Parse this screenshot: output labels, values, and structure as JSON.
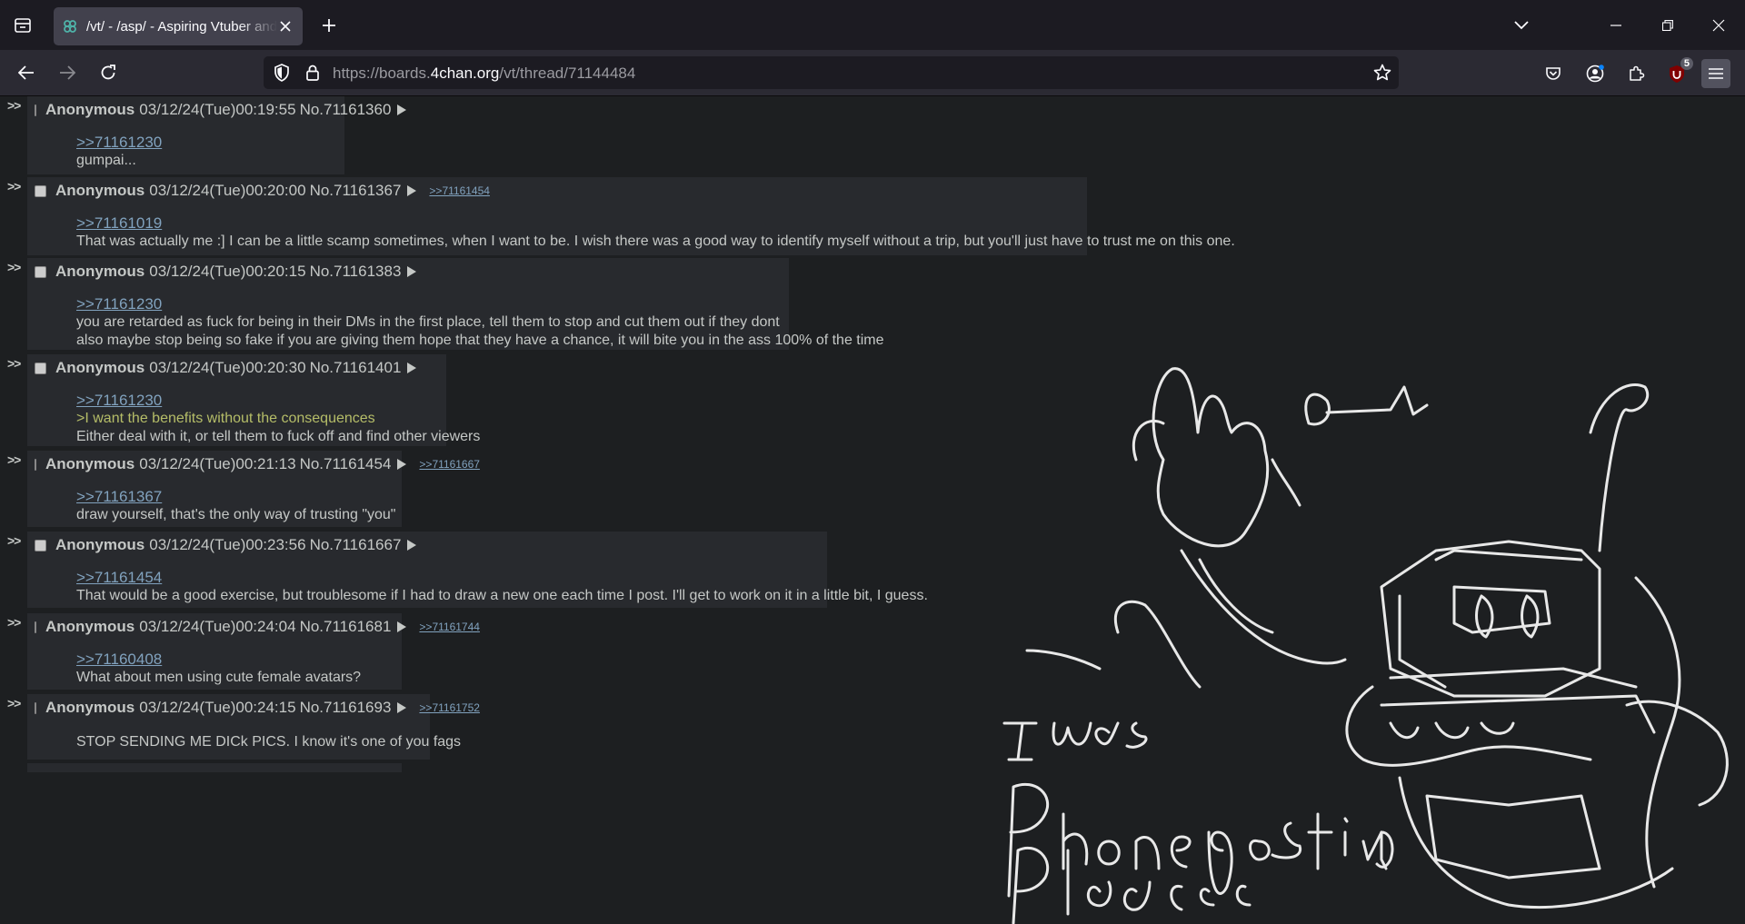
{
  "browser": {
    "tab_title": "/vt/ - /asp/ - Aspiring Vtuber and",
    "url_prefix": "https://boards.",
    "url_domain": "4chan.org",
    "url_path": "/vt/thread/71144484",
    "extension_badge": "5"
  },
  "posts": [
    {
      "arrows": ">>",
      "name": "Anonymous",
      "datetime": "03/12/24(Tue)00:19:55",
      "number": "No.71161360",
      "backlinks": [],
      "quote": ">>71161230",
      "greentext": "",
      "lines": [
        "gumpai..."
      ]
    },
    {
      "arrows": ">>",
      "name": "Anonymous",
      "datetime": "03/12/24(Tue)00:20:00",
      "number": "No.71161367",
      "backlinks": [
        ">>71161454"
      ],
      "quote": ">>71161019",
      "greentext": "",
      "lines": [
        "That was actually me :] I can be a little scamp sometimes, when I want to be. I wish there was a good way to identify myself without a trip, but you'll just have to trust me on this one."
      ]
    },
    {
      "arrows": ">>",
      "name": "Anonymous",
      "datetime": "03/12/24(Tue)00:20:15",
      "number": "No.71161383",
      "backlinks": [],
      "quote": ">>71161230",
      "greentext": "",
      "lines": [
        "you are retarded as fuck for being in their DMs in the first place, tell them to stop and cut them out if they dont",
        "also maybe stop being so fake if you are giving them hope that they have a chance, it will bite you in the ass 100% of the time"
      ]
    },
    {
      "arrows": ">>",
      "name": "Anonymous",
      "datetime": "03/12/24(Tue)00:20:30",
      "number": "No.71161401",
      "backlinks": [],
      "quote": ">>71161230",
      "greentext": ">I want the benefits without the consequences",
      "lines": [
        "Either deal with it, or tell them to fuck off and find other viewers"
      ]
    },
    {
      "arrows": ">>",
      "name": "Anonymous",
      "datetime": "03/12/24(Tue)00:21:13",
      "number": "No.71161454",
      "backlinks": [
        ">>71161667"
      ],
      "quote": ">>71161367",
      "greentext": "",
      "lines": [
        "draw yourself, that's the only way of trusting \"you\""
      ]
    },
    {
      "arrows": ">>",
      "name": "Anonymous",
      "datetime": "03/12/24(Tue)00:23:56",
      "number": "No.71161667",
      "backlinks": [],
      "quote": ">>71161454",
      "greentext": "",
      "lines": [
        "That would be a good exercise, but troublesome if I had to draw a new one each time I post. I'll get to work on it in a little bit, I guess."
      ]
    },
    {
      "arrows": ">>",
      "name": "Anonymous",
      "datetime": "03/12/24(Tue)00:24:04",
      "number": "No.71161681",
      "backlinks": [
        ">>71161744"
      ],
      "quote": ">>71160408",
      "greentext": "",
      "lines": [
        "What about men using cute female avatars?"
      ]
    },
    {
      "arrows": ">>",
      "name": "Anonymous",
      "datetime": "03/12/24(Tue)00:24:15",
      "number": "No.71161693",
      "backlinks": [
        ">>71161752"
      ],
      "quote": "",
      "greentext": "",
      "lines": [
        "STOP SENDING ME DICk PICS. I know it's one of you fags"
      ]
    }
  ]
}
